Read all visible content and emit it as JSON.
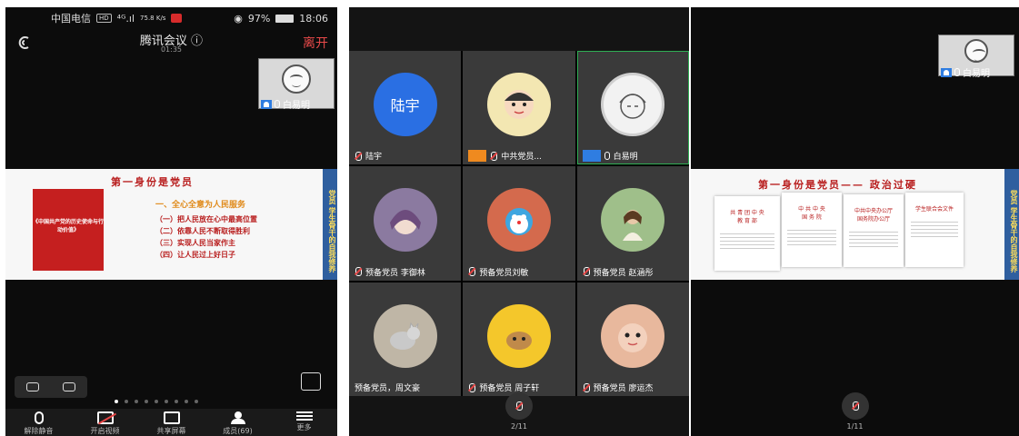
{
  "panel1": {
    "status": {
      "carrier": "中国电信",
      "hd": "HD",
      "signal": "⁴ᴳ.ıl",
      "speed": "75.8 K/s",
      "battery": "97%",
      "time": "18:06"
    },
    "title": "腾讯会议 ⓘ",
    "timer": "01:35",
    "leave": "离开",
    "thumb_name": "白易明",
    "slide": {
      "title": "第一身份是党员",
      "side": "党员 学生骨干的自我修养",
      "book": "《中国共产党的历史使命与行动价值》",
      "bullets_head": "一、全心全意为人民服务",
      "bullets": [
        "（一）把人民放在心中最高位置",
        "（二）依靠人民不断取得胜利",
        "（三）实现人民当家作主",
        "（四）让人民过上好日子"
      ]
    },
    "toolbar": [
      {
        "label": "解除静音",
        "icon": "mic-muted-icon"
      },
      {
        "label": "开启视频",
        "icon": "camera-off-icon"
      },
      {
        "label": "共享屏幕",
        "icon": "share-screen-icon"
      },
      {
        "label": "成员(69)",
        "icon": "members-icon"
      },
      {
        "label": "更多",
        "icon": "more-icon"
      }
    ]
  },
  "panel2": {
    "tiles": [
      {
        "name": "陆宇",
        "avatar_text": "陆宇",
        "kind": "blue"
      },
      {
        "name": "中共党员...",
        "kind": "photo",
        "badge": "orange"
      },
      {
        "name": "白易明",
        "kind": "sketch",
        "badge": "blue",
        "active": true
      },
      {
        "name": "预备党员 李御林",
        "kind": "photo"
      },
      {
        "name": "预备党员刘敏",
        "kind": "photo"
      },
      {
        "name": "预备党员 赵涵彤",
        "kind": "photo"
      },
      {
        "name": "预备党员，周文豪",
        "kind": "photo",
        "muted_hidden": true
      },
      {
        "name": "预备党员 周子轩",
        "kind": "photo"
      },
      {
        "name": "预备党员 廖运杰",
        "kind": "photo"
      }
    ],
    "page": "2/11"
  },
  "panel3": {
    "thumb_name": "白易明",
    "slide_title": "第一身份是党员—— 政治过硬",
    "side": "党员 学生骨干的自我修养",
    "page": "1/11"
  },
  "colors": {
    "leave_red": "#e84a4a",
    "host_blue": "#2f7de1",
    "slide_red": "#b81d1d",
    "active_green": "#2fae54"
  }
}
